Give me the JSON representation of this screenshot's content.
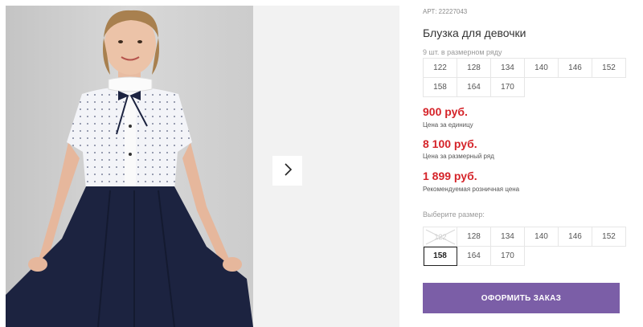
{
  "product": {
    "article": "АРТ: 22227043",
    "title": "Блузка для девочки",
    "pack_info": "9 шт. в размерном ряду",
    "row_sizes": [
      "122",
      "128",
      "134",
      "140",
      "146",
      "152",
      "158",
      "164",
      "170"
    ],
    "prices": [
      {
        "value": "900 руб.",
        "label": "Цена за единицу"
      },
      {
        "value": "8 100 руб.",
        "label": "Цена за размерный ряд"
      },
      {
        "value": "1 899 руб.",
        "label": "Рекомендуемая розничная цена"
      }
    ],
    "choose_label": "Выберите размер:",
    "size_options": [
      {
        "label": "122",
        "state": "disabled"
      },
      {
        "label": "128",
        "state": "available"
      },
      {
        "label": "134",
        "state": "available"
      },
      {
        "label": "140",
        "state": "available"
      },
      {
        "label": "146",
        "state": "available"
      },
      {
        "label": "152",
        "state": "available"
      },
      {
        "label": "158",
        "state": "selected"
      },
      {
        "label": "164",
        "state": "available"
      },
      {
        "label": "170",
        "state": "available"
      }
    ],
    "order_button": "ОФОРМИТЬ ЗАКАЗ"
  },
  "gallery": {
    "next_icon": "chevron-right-icon"
  },
  "colors": {
    "price": "#d5242a",
    "order_button": "#7b5ea7",
    "skirt": "#1c2340"
  }
}
